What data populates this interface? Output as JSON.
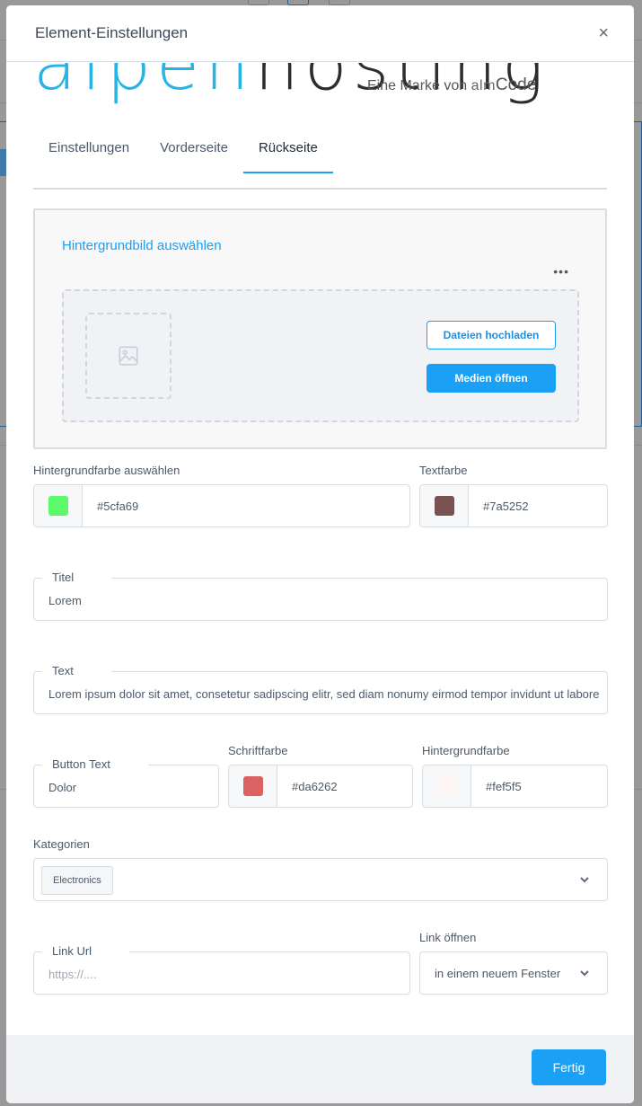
{
  "modal": {
    "title": "Element-Einstellungen",
    "close_icon": "×"
  },
  "logo": {
    "brand_part1": "alpen",
    "brand_part2": "hosting",
    "tagline_prefix": "Eine Marke von ",
    "tagline_alm": "alm",
    "tagline_code": "Code"
  },
  "tabs": [
    {
      "label": "Einstellungen",
      "active": false
    },
    {
      "label": "Vorderseite",
      "active": false
    },
    {
      "label": "Rückseite",
      "active": true
    }
  ],
  "background_image": {
    "title": "Hintergrundbild auswählen",
    "more_icon": "•••",
    "upload_button": "Dateien hochladen",
    "media_button": "Medien öffnen"
  },
  "background_color": {
    "label": "Hintergrundfarbe auswählen",
    "value": "#5cfa69",
    "swatch": "#5cfa69"
  },
  "text_color": {
    "label": "Textfarbe",
    "value": "#7a5252",
    "swatch": "#7a5252"
  },
  "title_field": {
    "label": "Titel",
    "value": "Lorem"
  },
  "text_field": {
    "label": "Text",
    "value": "Lorem ipsum dolor sit amet, consetetur sadipscing elitr, sed diam nonumy eirmod tempor invidunt ut labore"
  },
  "button_text": {
    "label": "Button Text",
    "value": "Dolor"
  },
  "button_font_color": {
    "label": "Schriftfarbe",
    "value": "#da6262",
    "swatch": "#da6262"
  },
  "button_bg_color": {
    "label": "Hintergrundfarbe",
    "value": "#fef5f5",
    "swatch": "#fef5f5"
  },
  "categories": {
    "label": "Kategorien",
    "selected": [
      "Electronics"
    ]
  },
  "link_url": {
    "label": "Link Url",
    "placeholder": "https://....",
    "value": ""
  },
  "link_open": {
    "label": "Link öffnen",
    "value": "in einem neuem Fenster"
  },
  "footer": {
    "done_button": "Fertig"
  },
  "colors": {
    "accent": "#1aa0f5",
    "overlay": "#999999"
  }
}
